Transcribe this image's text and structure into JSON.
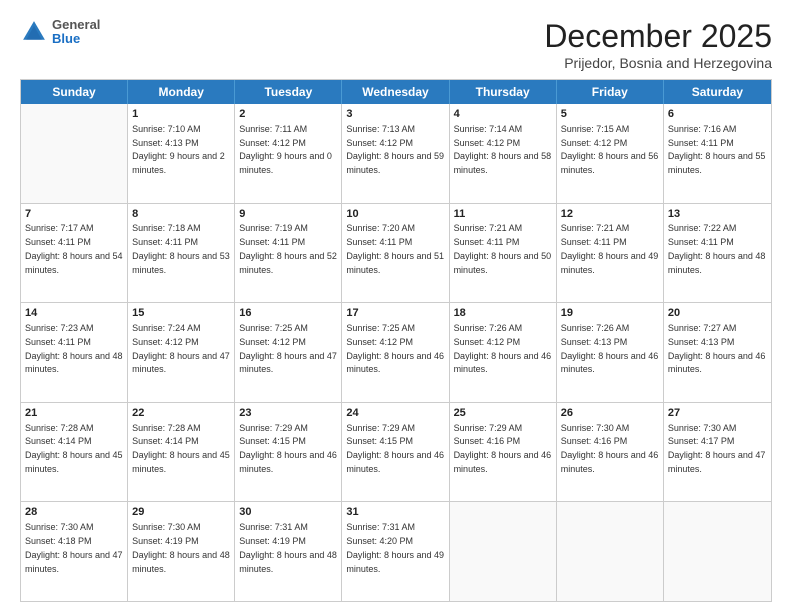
{
  "header": {
    "logo": {
      "general": "General",
      "blue": "Blue"
    },
    "title": "December 2025",
    "subtitle": "Prijedor, Bosnia and Herzegovina"
  },
  "calendar": {
    "days": [
      "Sunday",
      "Monday",
      "Tuesday",
      "Wednesday",
      "Thursday",
      "Friday",
      "Saturday"
    ],
    "rows": [
      [
        {
          "day": "",
          "sunrise": "",
          "sunset": "",
          "daylight": ""
        },
        {
          "day": "1",
          "sunrise": "Sunrise: 7:10 AM",
          "sunset": "Sunset: 4:13 PM",
          "daylight": "Daylight: 9 hours and 2 minutes."
        },
        {
          "day": "2",
          "sunrise": "Sunrise: 7:11 AM",
          "sunset": "Sunset: 4:12 PM",
          "daylight": "Daylight: 9 hours and 0 minutes."
        },
        {
          "day": "3",
          "sunrise": "Sunrise: 7:13 AM",
          "sunset": "Sunset: 4:12 PM",
          "daylight": "Daylight: 8 hours and 59 minutes."
        },
        {
          "day": "4",
          "sunrise": "Sunrise: 7:14 AM",
          "sunset": "Sunset: 4:12 PM",
          "daylight": "Daylight: 8 hours and 58 minutes."
        },
        {
          "day": "5",
          "sunrise": "Sunrise: 7:15 AM",
          "sunset": "Sunset: 4:12 PM",
          "daylight": "Daylight: 8 hours and 56 minutes."
        },
        {
          "day": "6",
          "sunrise": "Sunrise: 7:16 AM",
          "sunset": "Sunset: 4:11 PM",
          "daylight": "Daylight: 8 hours and 55 minutes."
        }
      ],
      [
        {
          "day": "7",
          "sunrise": "Sunrise: 7:17 AM",
          "sunset": "Sunset: 4:11 PM",
          "daylight": "Daylight: 8 hours and 54 minutes."
        },
        {
          "day": "8",
          "sunrise": "Sunrise: 7:18 AM",
          "sunset": "Sunset: 4:11 PM",
          "daylight": "Daylight: 8 hours and 53 minutes."
        },
        {
          "day": "9",
          "sunrise": "Sunrise: 7:19 AM",
          "sunset": "Sunset: 4:11 PM",
          "daylight": "Daylight: 8 hours and 52 minutes."
        },
        {
          "day": "10",
          "sunrise": "Sunrise: 7:20 AM",
          "sunset": "Sunset: 4:11 PM",
          "daylight": "Daylight: 8 hours and 51 minutes."
        },
        {
          "day": "11",
          "sunrise": "Sunrise: 7:21 AM",
          "sunset": "Sunset: 4:11 PM",
          "daylight": "Daylight: 8 hours and 50 minutes."
        },
        {
          "day": "12",
          "sunrise": "Sunrise: 7:21 AM",
          "sunset": "Sunset: 4:11 PM",
          "daylight": "Daylight: 8 hours and 49 minutes."
        },
        {
          "day": "13",
          "sunrise": "Sunrise: 7:22 AM",
          "sunset": "Sunset: 4:11 PM",
          "daylight": "Daylight: 8 hours and 48 minutes."
        }
      ],
      [
        {
          "day": "14",
          "sunrise": "Sunrise: 7:23 AM",
          "sunset": "Sunset: 4:11 PM",
          "daylight": "Daylight: 8 hours and 48 minutes."
        },
        {
          "day": "15",
          "sunrise": "Sunrise: 7:24 AM",
          "sunset": "Sunset: 4:12 PM",
          "daylight": "Daylight: 8 hours and 47 minutes."
        },
        {
          "day": "16",
          "sunrise": "Sunrise: 7:25 AM",
          "sunset": "Sunset: 4:12 PM",
          "daylight": "Daylight: 8 hours and 47 minutes."
        },
        {
          "day": "17",
          "sunrise": "Sunrise: 7:25 AM",
          "sunset": "Sunset: 4:12 PM",
          "daylight": "Daylight: 8 hours and 46 minutes."
        },
        {
          "day": "18",
          "sunrise": "Sunrise: 7:26 AM",
          "sunset": "Sunset: 4:12 PM",
          "daylight": "Daylight: 8 hours and 46 minutes."
        },
        {
          "day": "19",
          "sunrise": "Sunrise: 7:26 AM",
          "sunset": "Sunset: 4:13 PM",
          "daylight": "Daylight: 8 hours and 46 minutes."
        },
        {
          "day": "20",
          "sunrise": "Sunrise: 7:27 AM",
          "sunset": "Sunset: 4:13 PM",
          "daylight": "Daylight: 8 hours and 46 minutes."
        }
      ],
      [
        {
          "day": "21",
          "sunrise": "Sunrise: 7:28 AM",
          "sunset": "Sunset: 4:14 PM",
          "daylight": "Daylight: 8 hours and 45 minutes."
        },
        {
          "day": "22",
          "sunrise": "Sunrise: 7:28 AM",
          "sunset": "Sunset: 4:14 PM",
          "daylight": "Daylight: 8 hours and 45 minutes."
        },
        {
          "day": "23",
          "sunrise": "Sunrise: 7:29 AM",
          "sunset": "Sunset: 4:15 PM",
          "daylight": "Daylight: 8 hours and 46 minutes."
        },
        {
          "day": "24",
          "sunrise": "Sunrise: 7:29 AM",
          "sunset": "Sunset: 4:15 PM",
          "daylight": "Daylight: 8 hours and 46 minutes."
        },
        {
          "day": "25",
          "sunrise": "Sunrise: 7:29 AM",
          "sunset": "Sunset: 4:16 PM",
          "daylight": "Daylight: 8 hours and 46 minutes."
        },
        {
          "day": "26",
          "sunrise": "Sunrise: 7:30 AM",
          "sunset": "Sunset: 4:16 PM",
          "daylight": "Daylight: 8 hours and 46 minutes."
        },
        {
          "day": "27",
          "sunrise": "Sunrise: 7:30 AM",
          "sunset": "Sunset: 4:17 PM",
          "daylight": "Daylight: 8 hours and 47 minutes."
        }
      ],
      [
        {
          "day": "28",
          "sunrise": "Sunrise: 7:30 AM",
          "sunset": "Sunset: 4:18 PM",
          "daylight": "Daylight: 8 hours and 47 minutes."
        },
        {
          "day": "29",
          "sunrise": "Sunrise: 7:30 AM",
          "sunset": "Sunset: 4:19 PM",
          "daylight": "Daylight: 8 hours and 48 minutes."
        },
        {
          "day": "30",
          "sunrise": "Sunrise: 7:31 AM",
          "sunset": "Sunset: 4:19 PM",
          "daylight": "Daylight: 8 hours and 48 minutes."
        },
        {
          "day": "31",
          "sunrise": "Sunrise: 7:31 AM",
          "sunset": "Sunset: 4:20 PM",
          "daylight": "Daylight: 8 hours and 49 minutes."
        },
        {
          "day": "",
          "sunrise": "",
          "sunset": "",
          "daylight": ""
        },
        {
          "day": "",
          "sunrise": "",
          "sunset": "",
          "daylight": ""
        },
        {
          "day": "",
          "sunrise": "",
          "sunset": "",
          "daylight": ""
        }
      ]
    ]
  }
}
